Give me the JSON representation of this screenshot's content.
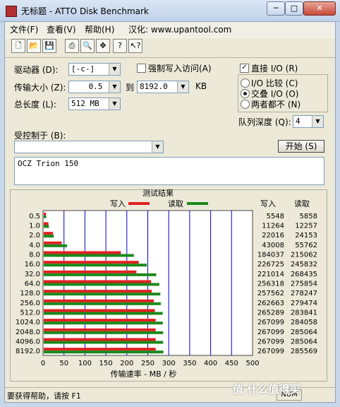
{
  "window": {
    "title": "无标题 - ATTO Disk Benchmark"
  },
  "caption_buttons": {
    "minimize": "─",
    "maximize": "□",
    "close": "✕"
  },
  "menu": [
    "文件(F)",
    "查看(V)",
    "帮助(H)",
    "汉化: www.upantool.com"
  ],
  "toolbar": [
    "new-icon",
    "open-icon",
    "save-icon",
    "print-icon",
    "print-preview-icon",
    "move-icon",
    "help-icon",
    "context-help-icon"
  ],
  "form": {
    "drive_label": "驱动器 (D):",
    "drive_value": "[-c-]",
    "force_write_label": "强制写入访问(A)",
    "force_write_checked": false,
    "transfer_label": "传输大小 (Z):",
    "transfer_from": "0.5",
    "to_label": "到",
    "transfer_to": "8192.0",
    "kb_unit": "KB",
    "length_label": "总长度 (L):",
    "length_value": "512 MB",
    "direct_io_label": "直接 I/O (R)",
    "direct_io_checked": true,
    "io_compare_label": "I/O 比较 (C)",
    "overlapped_label": "交叠 I/O (O)",
    "neither_label": "两者都不 (N)",
    "selected_mode": "overlapped",
    "queue_label": "队列深度 (Q):",
    "queue_value": "4",
    "controlled_by_label": "受控制于 (B):",
    "controlled_by_value": "",
    "start_button": "开始 (S)",
    "description": "OCZ Trion 150"
  },
  "results": {
    "title": "测试结果",
    "write_legend": "写入",
    "read_legend": "读取",
    "write_header": "写入",
    "read_header": "读取",
    "xlabel": "传输速率 - MB / 秒",
    "write_color": "#e02020",
    "read_color": "#1a8a1a"
  },
  "chart_data": {
    "type": "bar",
    "orientation": "horizontal",
    "categories": [
      "0.5",
      "1.0",
      "2.0",
      "4.0",
      "8.0",
      "16.0",
      "32.0",
      "64.0",
      "128.0",
      "256.0",
      "512.0",
      "1024.0",
      "2048.0",
      "4096.0",
      "8192.0"
    ],
    "series": [
      {
        "name": "写入",
        "values": [
          5548,
          11264,
          22016,
          43008,
          184037,
          226725,
          221014,
          256318,
          257562,
          262663,
          265289,
          267099,
          267099,
          267099,
          267099
        ]
      },
      {
        "name": "读取",
        "values": [
          5858,
          12257,
          24153,
          55762,
          215062,
          245832,
          268435,
          275854,
          278247,
          279474,
          283841,
          284058,
          285064,
          285064,
          285569
        ]
      }
    ],
    "x_ticks": [
      "0",
      "50",
      "100",
      "150",
      "200",
      "250",
      "300",
      "350",
      "400",
      "450",
      "500"
    ],
    "xlim": [
      0,
      500
    ],
    "xlabel": "传输速率 - MB / 秒",
    "value_unit_note": "KB/s in table, MB/s on axis"
  },
  "status": {
    "text": "要获得帮助，请按 F1",
    "num": "NUM"
  },
  "watermark": "值 什么值得买"
}
